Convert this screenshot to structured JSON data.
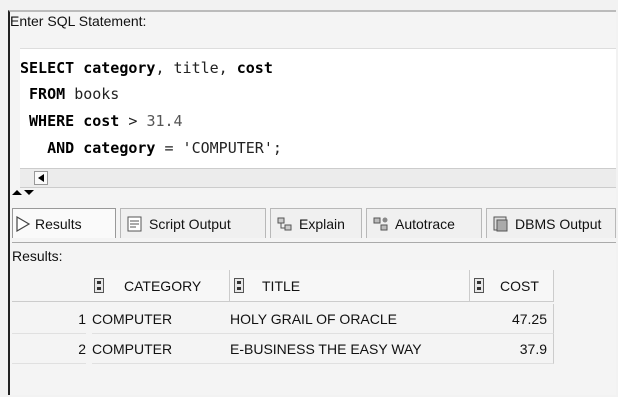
{
  "editor": {
    "label": "Enter SQL Statement:",
    "lines": [
      [
        {
          "t": "SELECT ",
          "k": true
        },
        {
          "t": "category",
          "k": true
        },
        {
          "t": ", title, ",
          "k": false
        },
        {
          "t": "cost",
          "k": true
        }
      ],
      [
        {
          "t": " FROM ",
          "k": true
        },
        {
          "t": "books",
          "k": false
        }
      ],
      [
        {
          "t": " WHERE ",
          "k": true
        },
        {
          "t": "cost",
          "k": true
        },
        {
          "t": " > ",
          "k": false
        },
        {
          "t": "31.4",
          "n": true
        }
      ],
      [
        {
          "t": "   AND ",
          "k": true
        },
        {
          "t": "category",
          "k": true
        },
        {
          "t": " = 'COMPUTER';",
          "k": false
        }
      ]
    ]
  },
  "tabs": [
    {
      "label": "Results",
      "icon": "play-triangle-icon"
    },
    {
      "label": "Script Output",
      "icon": "script-output-icon"
    },
    {
      "label": "Explain",
      "icon": "explain-plan-icon"
    },
    {
      "label": "Autotrace",
      "icon": "autotrace-icon"
    },
    {
      "label": "DBMS Output",
      "icon": "dbms-output-icon"
    }
  ],
  "results": {
    "label": "Results:",
    "columns": [
      "CATEGORY",
      "TITLE",
      "COST"
    ],
    "rows": [
      {
        "n": "1",
        "category": "COMPUTER",
        "title": "HOLY GRAIL OF ORACLE",
        "cost": "47.25"
      },
      {
        "n": "2",
        "category": "COMPUTER",
        "title": "E-BUSINESS THE EASY WAY",
        "cost": "37.9"
      }
    ]
  }
}
